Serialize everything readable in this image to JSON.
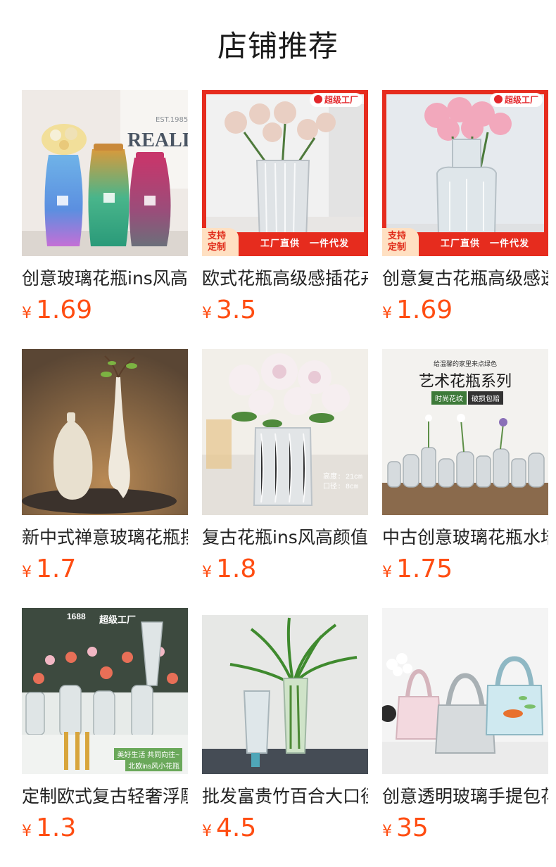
{
  "page": {
    "title": "店铺推荐"
  },
  "overlays": {
    "super_factory": "超级工厂",
    "support_line1": "支持",
    "support_line2": "定制",
    "factory_direct": "工厂直供　一件代发",
    "brand_1688": "1688",
    "series_subtitle": "给温馨的家里来点绿色",
    "series_title": "艺术花瓶系列",
    "series_tag1": "时尚花纹",
    "series_tag2": "破损包赔",
    "dim_height": "高度: 21cm",
    "dim_diameter": "口径: 8cm",
    "slogan1": "美好生活 共同向往~",
    "slogan2": "北欧ins风小花瓶"
  },
  "products": [
    {
      "name": "创意玻璃花瓶ins风高",
      "currency": "¥",
      "price": "1.69",
      "image": "gradient-vases-photo"
    },
    {
      "name": "欧式花瓶高级感插花卉",
      "currency": "¥",
      "price": "3.5",
      "image": "textured-glass-vase-roses-photo"
    },
    {
      "name": "创意复古花瓶高级感透",
      "currency": "¥",
      "price": "1.69",
      "image": "retro-glass-vase-pink-roses-photo"
    },
    {
      "name": "新中式禅意玻璃花瓶摆",
      "currency": "¥",
      "price": "1.7",
      "image": "zen-vases-photo"
    },
    {
      "name": "复古花瓶ins风高颜值",
      "currency": "¥",
      "price": "1.8",
      "image": "white-roses-vase-photo"
    },
    {
      "name": "中古创意玻璃花瓶水培",
      "currency": "¥",
      "price": "1.75",
      "image": "art-vase-series-photo"
    },
    {
      "name": "定制欧式复古轻奢浮雕",
      "currency": "¥",
      "price": "1.3",
      "image": "vintage-glass-vases-photo"
    },
    {
      "name": "批发富贵竹百合大口径",
      "currency": "¥",
      "price": "4.5",
      "image": "bamboo-vase-photo"
    },
    {
      "name": "创意透明玻璃手提包花",
      "currency": "¥",
      "price": "35",
      "image": "handbag-glass-vases-photo"
    }
  ]
}
